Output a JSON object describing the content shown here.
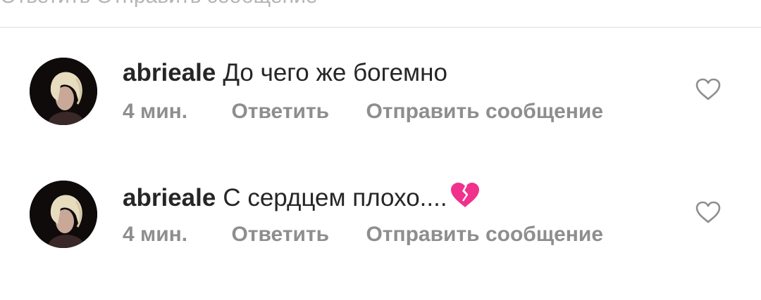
{
  "top_partial_text": "Ответить   Отправить сообщение",
  "comments": [
    {
      "username": "abrieale",
      "text": "До чего же богемно",
      "emoji": "",
      "time": "4 мин.",
      "reply_label": "Ответить",
      "message_label": "Отправить сообщение",
      "like_icon": "heart-outline-icon"
    },
    {
      "username": "abrieale",
      "text": "С сердцем плохо....",
      "emoji": "broken-heart-emoji",
      "time": "4 мин.",
      "reply_label": "Ответить",
      "message_label": "Отправить сообщение",
      "like_icon": "heart-outline-icon"
    }
  ],
  "colors": {
    "text": "#262626",
    "secondary": "#8e8e8e",
    "divider": "#ececec",
    "broken_heart": "#f0328c"
  }
}
